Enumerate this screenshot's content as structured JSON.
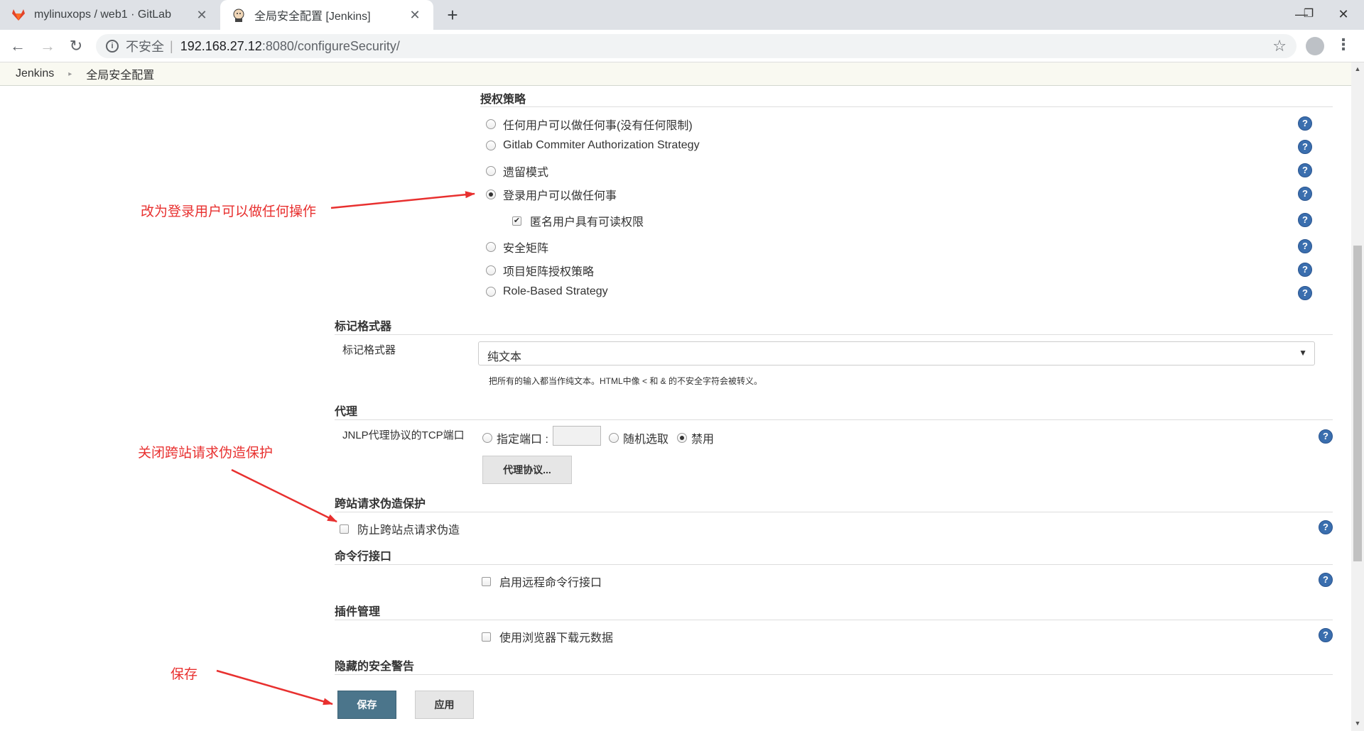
{
  "browser": {
    "tabs": [
      {
        "title": "mylinuxops / web1 · GitLab",
        "close": "✕",
        "active": false
      },
      {
        "title": "全局安全配置 [Jenkins]",
        "close": "✕",
        "active": true
      }
    ],
    "new_tab": "+",
    "window": {
      "minimize": "—",
      "maximize": "❐",
      "close": "✕"
    },
    "nav": {
      "back": "←",
      "forward": "→",
      "reload": "↻"
    },
    "address": {
      "insecure_label": "不安全",
      "separator": "|",
      "host": "192.168.27.12",
      "path": ":8080/configureSecurity/",
      "star": "☆"
    },
    "menu": "⋮"
  },
  "breadcrumb": {
    "items": [
      "Jenkins",
      "全局安全配置"
    ],
    "separator": "▸"
  },
  "authorization": {
    "title": "授权策略",
    "options": [
      {
        "label": "任何用户可以做任何事(没有任何限制)",
        "selected": false
      },
      {
        "label": "Gitlab Commiter Authorization Strategy",
        "selected": false
      },
      {
        "label": "遗留模式",
        "selected": false
      },
      {
        "label": "登录用户可以做任何事",
        "selected": true
      },
      {
        "label": "安全矩阵",
        "selected": false
      },
      {
        "label": "项目矩阵授权策略",
        "selected": false
      },
      {
        "label": "Role-Based Strategy",
        "selected": false
      }
    ],
    "anonymous_read": {
      "label": "匿名用户具有可读权限",
      "checked": true,
      "mark": "✔"
    }
  },
  "markup": {
    "title": "标记格式器",
    "field_label": "标记格式器",
    "selected": "纯文本",
    "caret": "▼",
    "hint": "把所有的输入都当作纯文本。HTML中像 < 和 & 的不安全字符会被转义。"
  },
  "proxy": {
    "title": "代理",
    "field_label": "JNLP代理协议的TCP端口",
    "options": [
      {
        "label": "指定端口 :",
        "selected": false
      },
      {
        "label": "随机选取",
        "selected": false
      },
      {
        "label": "禁用",
        "selected": true
      }
    ],
    "protocols_button": "代理协议..."
  },
  "csrf": {
    "title": "跨站请求伪造保护",
    "checkbox": {
      "label": "防止跨站点请求伪造",
      "checked": false
    }
  },
  "cli": {
    "title": "命令行接口",
    "checkbox": {
      "label": "启用远程命令行接口",
      "checked": false
    }
  },
  "plugins": {
    "title": "插件管理",
    "checkbox": {
      "label": "使用浏览器下载元数据",
      "checked": false
    }
  },
  "hidden_warnings": {
    "title": "隐藏的安全警告"
  },
  "help_glyph": "?",
  "actions": {
    "save": "保存",
    "apply": "应用"
  },
  "annotations": {
    "auth": "改为登录用户可以做任何操作",
    "csrf": "关闭跨站请求伪造保护",
    "save": "保存"
  },
  "colors": {
    "annotation": "#e8302f",
    "primary_button": "#4b758b",
    "help": "#3a6eae",
    "breadcrumb_bg": "#f9f9f1"
  }
}
